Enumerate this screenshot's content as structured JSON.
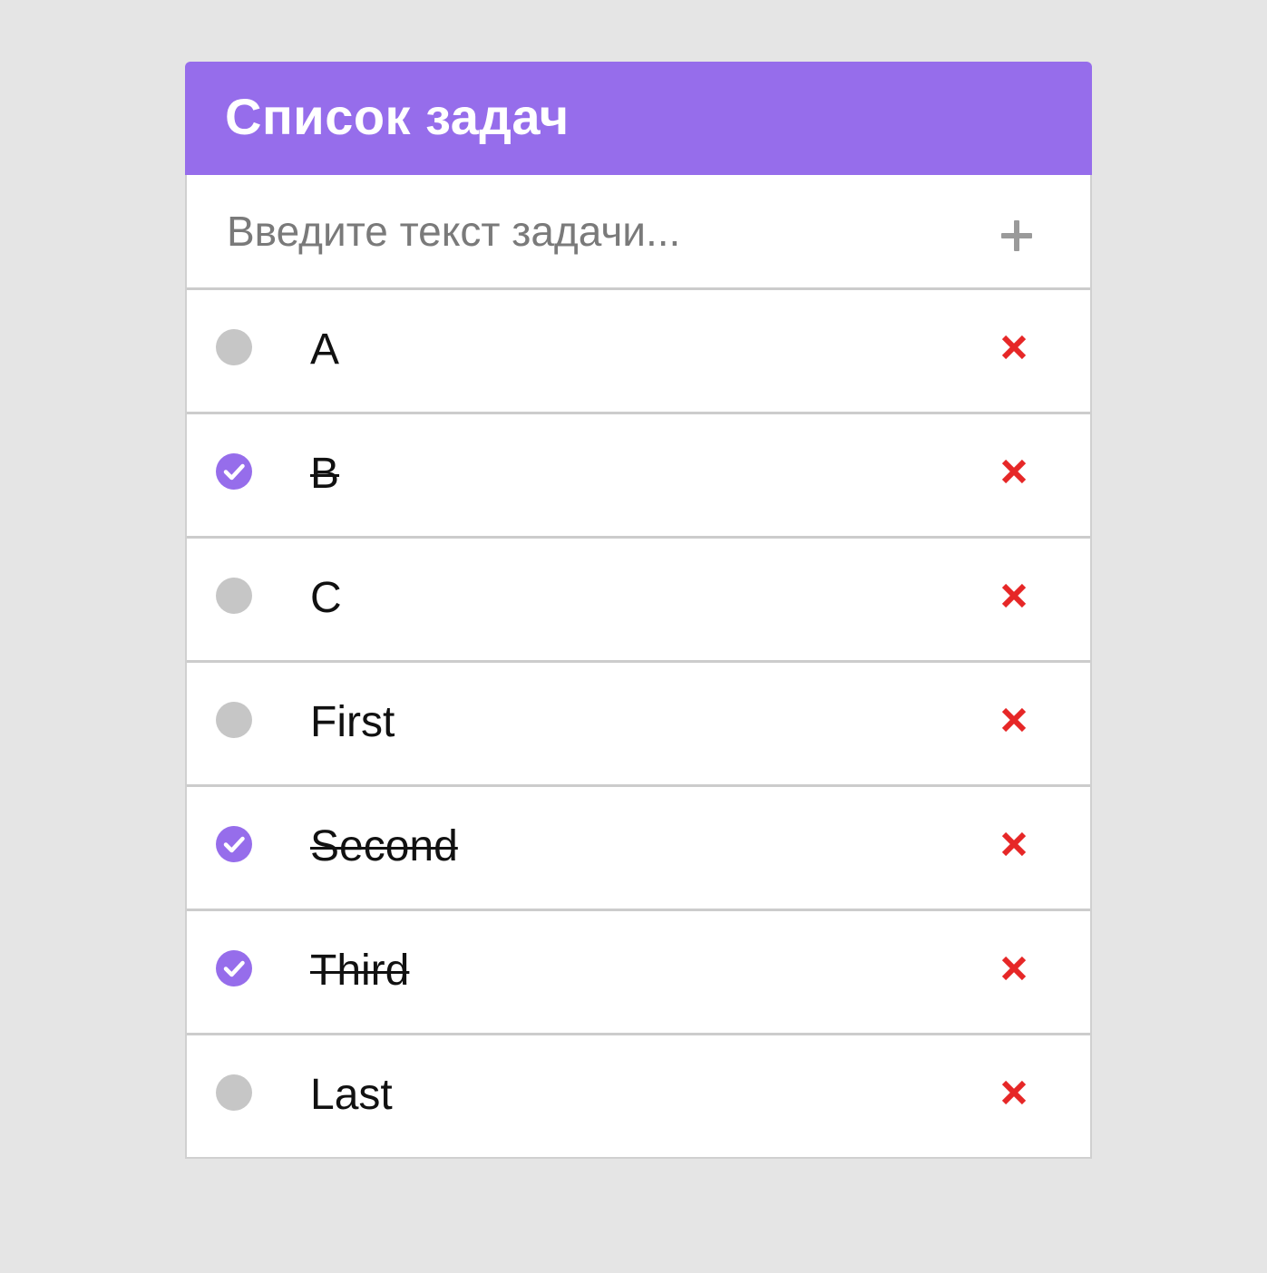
{
  "header": {
    "title": "Список задач"
  },
  "add_task": {
    "placeholder": "Введите текст задачи...",
    "value": "",
    "add_icon": "plus-icon"
  },
  "tasks": [
    {
      "text": "A",
      "done": false
    },
    {
      "text": "B",
      "done": true
    },
    {
      "text": "C",
      "done": false
    },
    {
      "text": "First",
      "done": false
    },
    {
      "text": "Second",
      "done": true
    },
    {
      "text": "Third",
      "done": true
    },
    {
      "text": "Last",
      "done": false
    }
  ],
  "icons": {
    "done": "check-circle-icon",
    "not_done": "circle-icon",
    "delete": "close-icon"
  },
  "colors": {
    "accent": "#966deb",
    "delete": "#e62727",
    "unchecked": "#c6c6c6",
    "background": "#e5e5e5"
  }
}
